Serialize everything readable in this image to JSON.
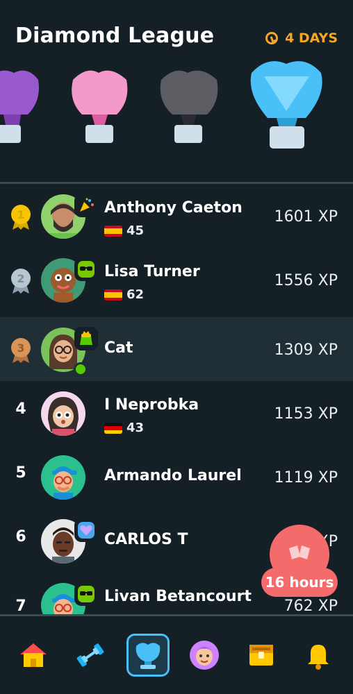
{
  "header": {
    "title": "Diamond League",
    "timer": "4 DAYS"
  },
  "leaderboard": [
    {
      "rank": "1",
      "name": "Anthony Caeton",
      "flag": "spain",
      "streak": "45",
      "xp": "1601 XP",
      "badge": "party-popper"
    },
    {
      "rank": "2",
      "name": "Lisa Turner",
      "flag": "spain",
      "streak": "62",
      "xp": "1556 XP",
      "badge": "sunglasses"
    },
    {
      "rank": "3",
      "name": "Cat",
      "xp": "1309 XP",
      "badge": "money-bag",
      "online": true
    },
    {
      "rank": "4",
      "name": "I Neprobka",
      "flag": "germany",
      "streak": "43",
      "xp": "1153 XP"
    },
    {
      "rank": "5",
      "name": "Armando Laurel",
      "xp": "1119 XP"
    },
    {
      "rank": "6",
      "name": "CARLOS T",
      "xp": "XP",
      "badge": "heart-gem"
    },
    {
      "rank": "7",
      "name": "Livan Betancourt",
      "xp": "762 XP",
      "badge": "sunglasses"
    }
  ],
  "floating": {
    "label": "16 hours"
  },
  "nav": [
    "home-icon",
    "dumbbell-icon",
    "trophy-icon",
    "profile-icon",
    "treasure-chest-icon",
    "bell-icon"
  ],
  "colors": {
    "background": "#141f26",
    "accent": "#49c0f8",
    "timer": "#f6a623",
    "gold": "#f7c500",
    "silver": "#b8c6d1",
    "bronze": "#d8955a",
    "float": "#f46b6b"
  }
}
